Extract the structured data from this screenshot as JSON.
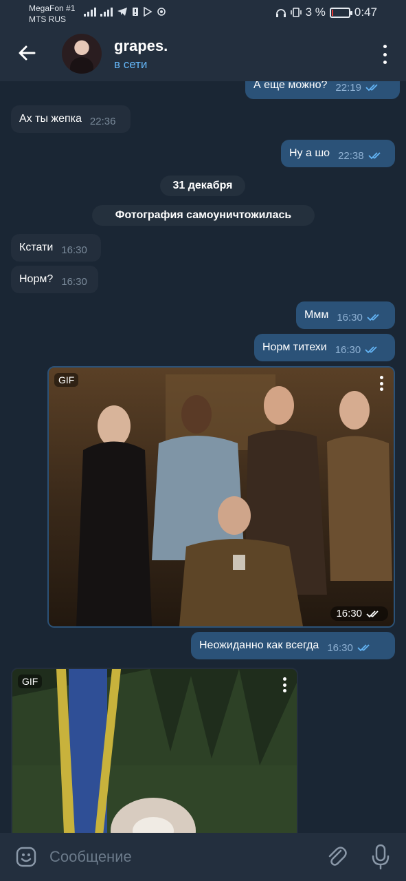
{
  "status_bar": {
    "carrier1": "MegaFon #1",
    "carrier2": "MTS RUS",
    "battery_percent": "3 %",
    "battery_level": 0.03,
    "time": "0:47"
  },
  "header": {
    "title": "grapes.",
    "status": "в сети"
  },
  "messages": [
    {
      "dir": "out",
      "text": "А еще можно?",
      "time": "22:19"
    },
    {
      "dir": "in",
      "text": "Ах ты жепка",
      "time": "22:36"
    },
    {
      "dir": "out",
      "text": "Ну а шо",
      "time": "22:38"
    },
    {
      "dir": "in",
      "text": "Кстати",
      "time": "16:30"
    },
    {
      "dir": "in",
      "text": "Норм?",
      "time": "16:30"
    },
    {
      "dir": "out",
      "text": "Ммм",
      "time": "16:30"
    },
    {
      "dir": "out",
      "text": "Норм титехи",
      "time": "16:30"
    },
    {
      "dir": "out",
      "text": "Неожиданно как всегда",
      "time": "16:30"
    }
  ],
  "service": {
    "date": "31 декабря",
    "photo_destroyed": "Фотография самоуничтожилась"
  },
  "gifs": [
    {
      "badge": "GIF",
      "time": "16:30"
    },
    {
      "badge": "GIF"
    }
  ],
  "input": {
    "placeholder": "Сообщение"
  },
  "colors": {
    "background": "#1a2634",
    "header": "#232f3e",
    "incoming_bubble": "#232e3c",
    "outgoing_bubble": "#2b5278",
    "accent": "#64b5f6"
  }
}
